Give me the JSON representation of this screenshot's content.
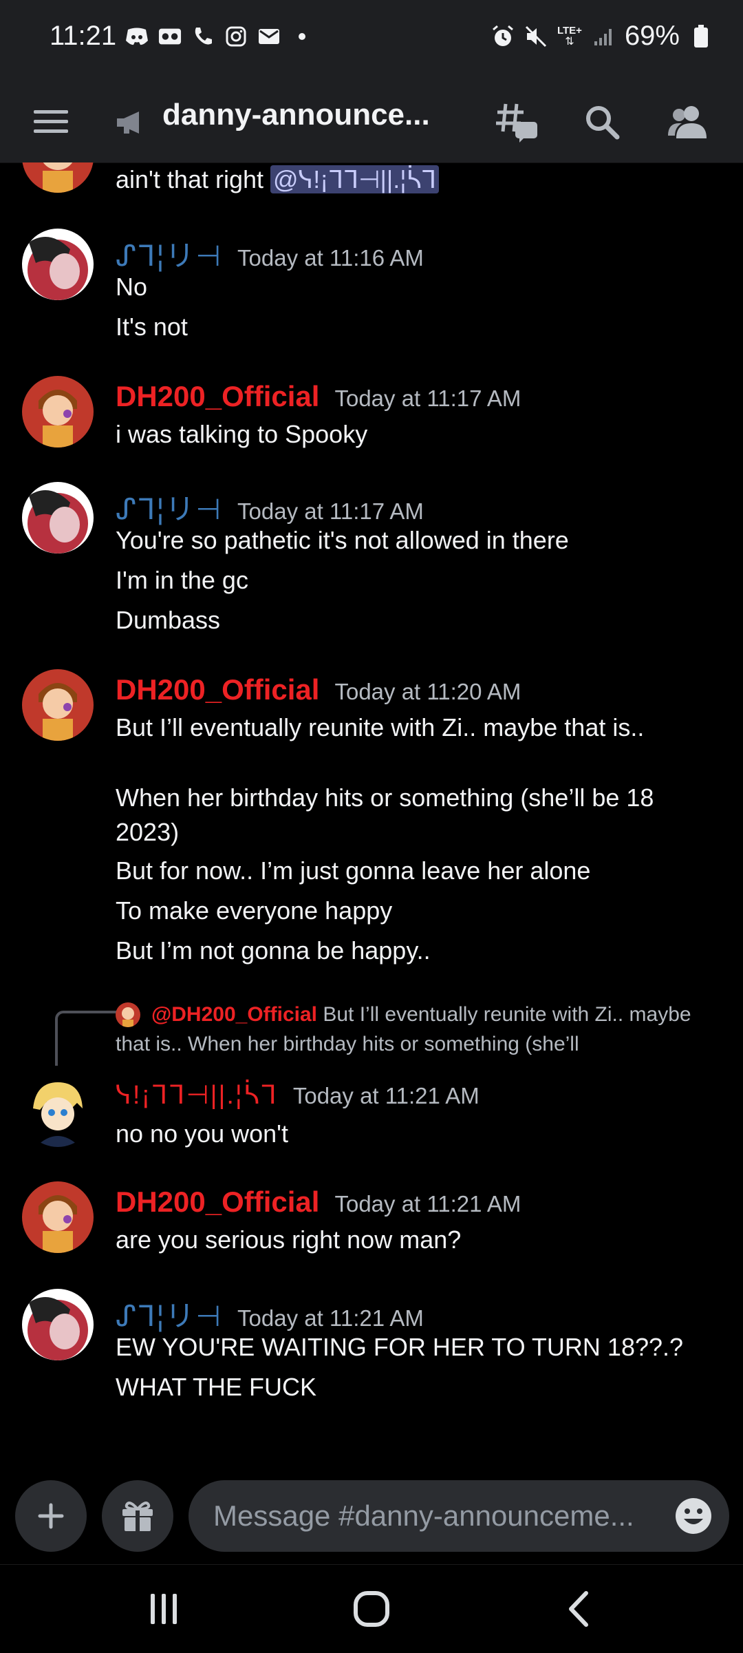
{
  "status_bar": {
    "time": "11:21",
    "network": "LTE+",
    "battery": "69%",
    "left_icons": [
      "discord-icon",
      "voicemail-icon",
      "call-icon",
      "instagram-icon",
      "mail-icon",
      "dot-icon"
    ],
    "right_icons": [
      "alarm-icon",
      "mute-icon",
      "lte-icon",
      "signal-icon",
      "battery-icon"
    ]
  },
  "header": {
    "channel_name": "danny-announce...",
    "icons": [
      "menu-icon",
      "announcement-channel-icon",
      "threads-icon",
      "search-icon",
      "members-icon"
    ]
  },
  "messages": [
    {
      "type": "continuation",
      "text": "ain't that right ",
      "mention": "@ᓭ!¡ᒣᒣ⊣||.¦ᓵᒣ"
    },
    {
      "author": "ᔑᒣ¦リ⊣",
      "author_color": "#3d7ab8",
      "timestamp": "Today at 11:16 AM",
      "lines": [
        "No",
        "It's not"
      ]
    },
    {
      "author": "DH200_Official",
      "author_color": "#ed2224",
      "timestamp": "Today at 11:17 AM",
      "lines": [
        "i was talking to Spooky"
      ]
    },
    {
      "author": "ᔑᒣ¦リ⊣",
      "author_color": "#3d7ab8",
      "timestamp": "Today at 11:17 AM",
      "lines": [
        "You're so pathetic it's not allowed in there",
        "I'm in the gc",
        "Dumbass"
      ]
    },
    {
      "author": "DH200_Official",
      "author_color": "#ed2224",
      "timestamp": "Today at 11:20 AM",
      "lines": [
        "But I’ll eventually reunite with Zi.. maybe that is..",
        "When her birthday hits or something (she’ll be 18 2023)",
        "But for now.. I’m just gonna leave her alone",
        "To make everyone happy",
        "But I’m not gonna be happy.."
      ]
    },
    {
      "reply_to": {
        "author": "@DH200_Official",
        "text": "But I’ll eventually reunite with Zi.. maybe that is..  When her birthday hits or something (she’ll"
      },
      "author": "ᓭ!¡ᒣᒣ⊣||.¦ᓵᒣ",
      "author_color": "#ed2224",
      "timestamp": "Today at 11:21 AM",
      "lines": [
        "no no you won't"
      ]
    },
    {
      "author": "DH200_Official",
      "author_color": "#ed2224",
      "timestamp": "Today at 11:21 AM",
      "lines": [
        "are you serious right now man?"
      ]
    },
    {
      "author": "ᔑᒣ¦リ⊣",
      "author_color": "#3d7ab8",
      "timestamp": "Today at 11:21 AM",
      "lines": [
        "EW YOU'RE WAITING FOR HER TO TURN 18??.?",
        "WHAT THE FUCK"
      ]
    }
  ],
  "composer": {
    "placeholder": "Message #danny-announceme...",
    "icons": [
      "plus-icon",
      "gift-icon",
      "emoji-icon"
    ]
  },
  "nav": {
    "icons": [
      "recents-icon",
      "home-icon",
      "back-icon"
    ]
  },
  "colors": {
    "background": "#000000",
    "header": "#1e1f22",
    "red_name": "#ed2224",
    "blue_name": "#3d7ab8",
    "timestamp": "#b5bac1"
  }
}
